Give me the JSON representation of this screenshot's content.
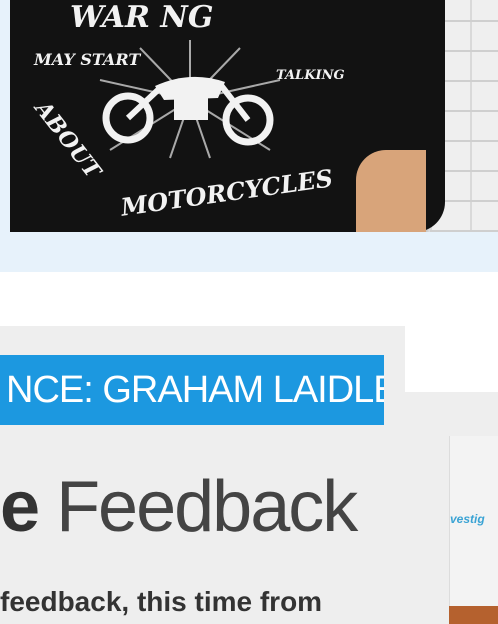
{
  "photo": {
    "shirt_lines": [
      "WAR NG",
      "MAY START",
      "TALKING",
      "ABOUT",
      "MOTORCYCLES"
    ]
  },
  "article": {
    "banner": "NCE: GRAHAM LAIDLER",
    "headline_bold": "e",
    "headline_rest": "Feedback",
    "summary": "feedback, this time from",
    "thumbnail_text": "vestig"
  }
}
